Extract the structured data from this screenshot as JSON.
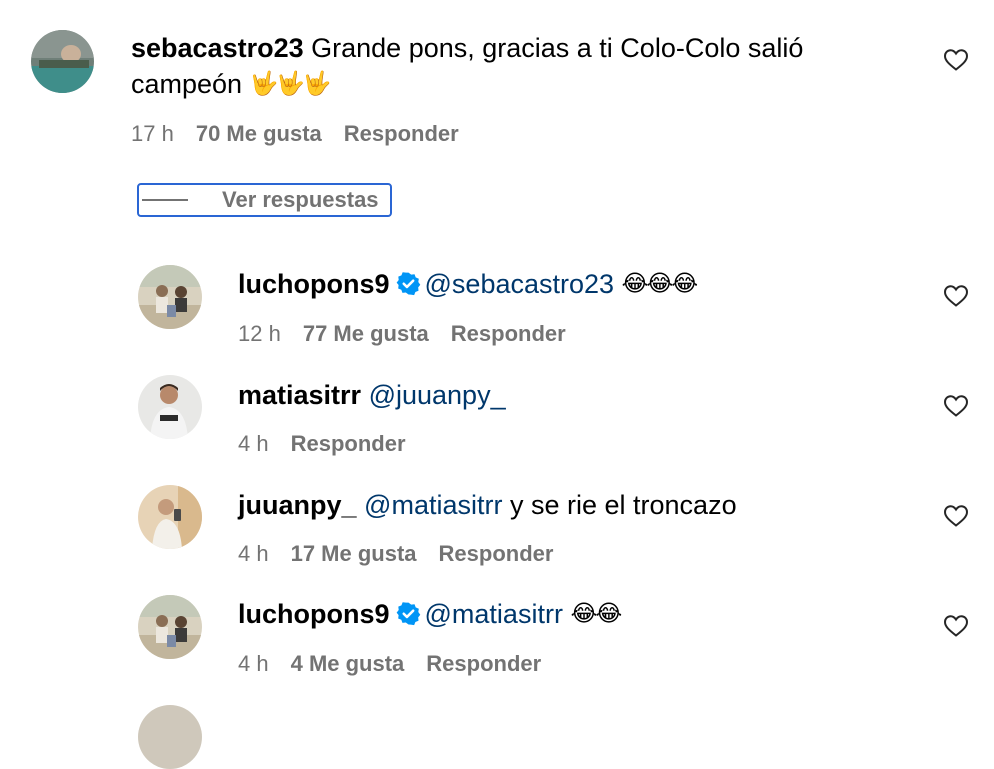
{
  "main_comment": {
    "username": "sebacastro23",
    "text": "Grande pons, gracias a ti Colo-Colo salió",
    "text_line2": "campeón",
    "emojis": "🤟🤟🤟",
    "time": "17 h",
    "likes": "70 Me gusta",
    "reply_label": "Responder",
    "avatar_icon": "avatar-photo-pool"
  },
  "view_replies": {
    "label": "Ver respuestas"
  },
  "replies": [
    {
      "username": "luchopons9",
      "verified": true,
      "mention": "@sebacastro23",
      "text": "",
      "emojis": "😂😂😂",
      "time": "12 h",
      "likes": "77 Me gusta",
      "reply_label": "Responder"
    },
    {
      "username": "matiasitrr",
      "verified": false,
      "mention": "@juuanpy_",
      "text": "",
      "emojis": "",
      "time": "4 h",
      "likes": "",
      "reply_label": "Responder"
    },
    {
      "username": "juuanpy_",
      "verified": false,
      "mention": "@matiasitrr",
      "text": "y se rie el troncazo",
      "emojis": "",
      "time": "4 h",
      "likes": "17 Me gusta",
      "reply_label": "Responder"
    },
    {
      "username": "luchopons9",
      "verified": true,
      "mention": "@matiasitrr",
      "text": "",
      "emojis": "😂😂",
      "time": "4 h",
      "likes": "4 Me gusta",
      "reply_label": "Responder"
    }
  ],
  "colors": {
    "mention": "#00376b",
    "meta": "#737373",
    "focus_ring": "#2a66d4",
    "verified": "#0095f6"
  },
  "icons": {
    "like": "heart-outline-icon",
    "verified": "verified-badge-icon"
  }
}
